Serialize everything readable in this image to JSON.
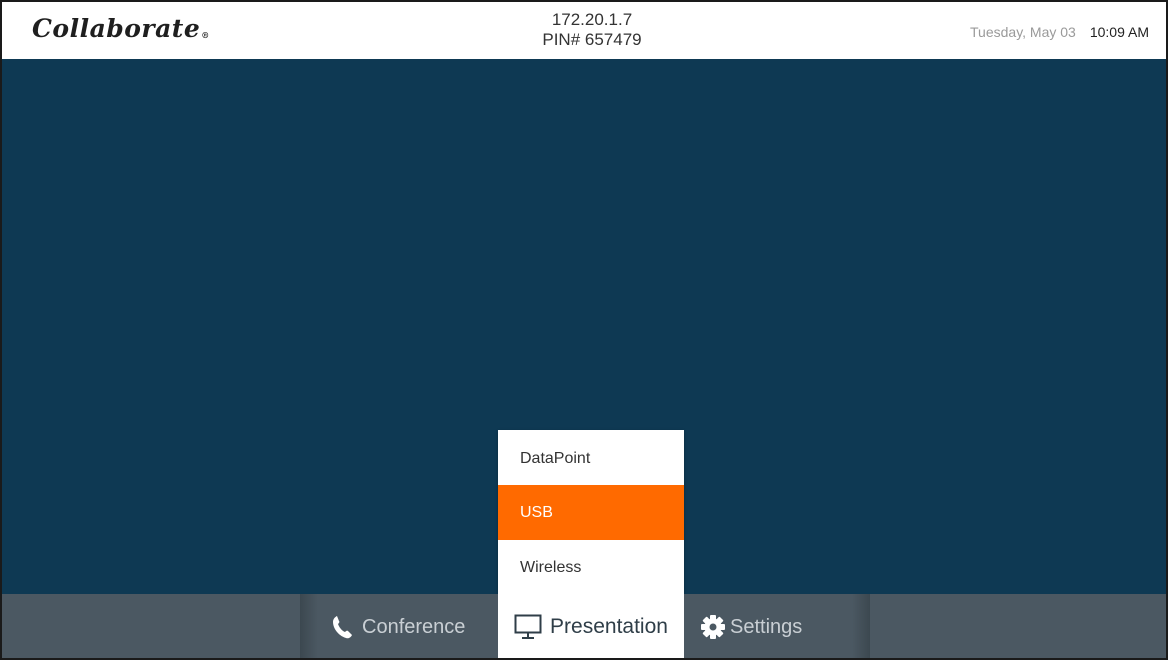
{
  "header": {
    "logo_text": "Collaborate",
    "logo_mark": "®",
    "ip_address": "172.20.1.7",
    "pin": "PIN# 657479",
    "date": "Tuesday, May 03",
    "time": "10:09 AM"
  },
  "presentation_menu": {
    "items": [
      {
        "label": "DataPoint",
        "selected": false
      },
      {
        "label": "USB",
        "selected": true
      },
      {
        "label": "Wireless",
        "selected": false
      }
    ]
  },
  "nav": {
    "conference": {
      "label": "Conference",
      "icon": "phone-icon"
    },
    "presentation": {
      "label": "Presentation",
      "icon": "monitor-icon"
    },
    "settings": {
      "label": "Settings",
      "icon": "gear-icon"
    }
  },
  "colors": {
    "main_background": "#0e3953",
    "nav_background": "#4b5862",
    "accent_selected": "#ff6a00"
  }
}
